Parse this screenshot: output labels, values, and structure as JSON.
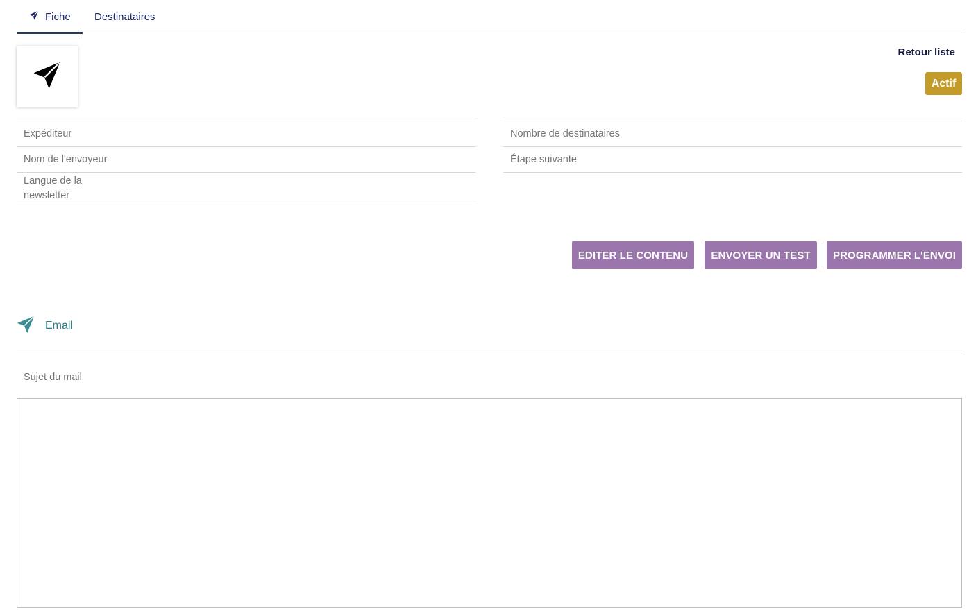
{
  "tabs": [
    {
      "label": "Fiche",
      "icon": "paper-plane-icon",
      "active": true
    },
    {
      "label": "Destinataires",
      "active": false
    }
  ],
  "header": {
    "logo_icon": "paper-plane-icon",
    "back_link": "Retour liste",
    "status_badge": "Actif"
  },
  "fields_left": [
    {
      "label": "Expéditeur",
      "value": ""
    },
    {
      "label": "Nom de l'envoyeur",
      "value": ""
    },
    {
      "label": "Langue de la newsletter",
      "value": ""
    }
  ],
  "fields_right": [
    {
      "label": "Nombre de destinataires",
      "value": ""
    },
    {
      "label": "Étape suivante",
      "value": ""
    }
  ],
  "actions": {
    "edit": "EDITER LE CONTENU",
    "test": "ENVOYER UN TEST",
    "schedule": "PROGRAMMER L'ENVOI"
  },
  "email_section": {
    "icon": "paper-plane-icon",
    "title": "Email",
    "subject_label": "Sujet du mail",
    "subject_value": ""
  },
  "colors": {
    "primary_navy": "#1a2460",
    "badge_gold": "#c39b2a",
    "button_purple": "#9b76ac",
    "email_teal": "#2f7f86"
  }
}
